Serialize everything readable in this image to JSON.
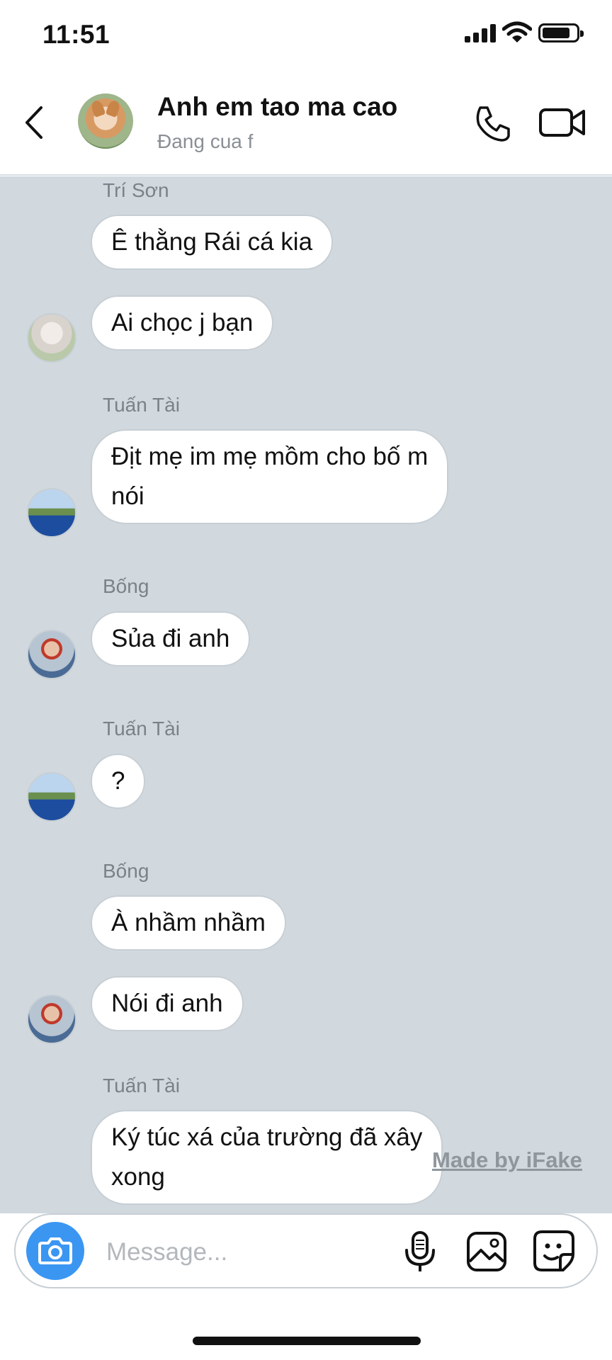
{
  "status_bar": {
    "time": "11:51"
  },
  "header": {
    "title": "Anh em tao ma cao",
    "status": "Đang cua f"
  },
  "messages": [
    {
      "sender": "Trí Sơn",
      "texts": [
        "Ê thằng Rái cá kia",
        "Ai chọc j bạn"
      ]
    },
    {
      "sender": "Tuấn Tài",
      "texts": [
        "Địt mẹ im mẹ mồm cho bố m\nnói"
      ]
    },
    {
      "sender": "Bống",
      "texts": [
        "Sủa đi anh"
      ]
    },
    {
      "sender": "Tuấn Tài",
      "texts": [
        "?"
      ]
    },
    {
      "sender": "Bống",
      "texts": [
        "À nhầm nhầm",
        "Nói đi anh"
      ]
    },
    {
      "sender": "Tuấn Tài",
      "texts": [
        "Ký túc xá của trường đã xây\nxong"
      ]
    }
  ],
  "watermark": "Made by iFake",
  "composer": {
    "placeholder": "Message..."
  },
  "colors": {
    "chat_background": "#d1d9df",
    "accent": "#3b96f2"
  }
}
